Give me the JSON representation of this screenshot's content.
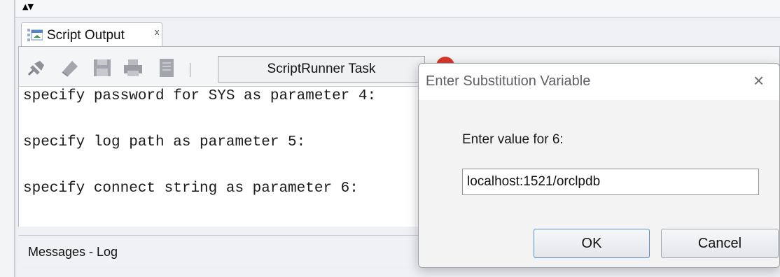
{
  "tab": {
    "label": "Script Output",
    "close": "x"
  },
  "toolbar": {
    "task_label": "ScriptRunner Task"
  },
  "output": {
    "lines": [
      "specify password for SYS as parameter 4:",
      "specify log path as parameter 5:",
      "specify connect string as parameter 6:"
    ]
  },
  "messages": {
    "label": "Messages - Log"
  },
  "dialog": {
    "title": "Enter Substitution Variable",
    "close": "×",
    "prompt": "Enter value for 6:",
    "value": "localhost:1521/orclpdb",
    "ok_label": "OK",
    "cancel_label": "Cancel"
  },
  "icons": {
    "collapse": "collapse-arrows-icon",
    "tab": "script-output-icon",
    "pin": "pin-icon",
    "eraser": "eraser-icon",
    "save": "save-icon",
    "print": "print-icon",
    "document": "document-icon",
    "stop": "stop-icon"
  },
  "colors": {
    "accent": "#5c8fd0",
    "stop": "#d73a2e"
  }
}
